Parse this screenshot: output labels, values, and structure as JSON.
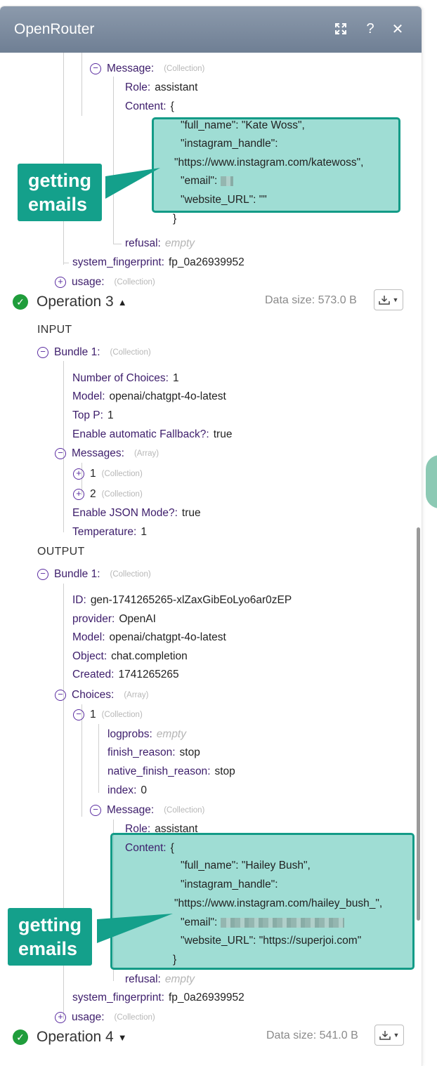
{
  "window": {
    "title": "OpenRouter"
  },
  "top": {
    "message_label": "Message",
    "collection": "(Collection)",
    "role_label": "Role",
    "role_value": "assistant",
    "content_label": "Content",
    "content_open": "{",
    "json_lines": [
      "\"full_name\": \"Kate Woss\",",
      "\"instagram_handle\":",
      "\"https://www.instagram.com/katewoss\",",
      "\"email\":",
      "\"website_URL\": \"\""
    ],
    "content_close": "}",
    "refusal_label": "refusal",
    "refusal_value": "empty",
    "fingerprint_label": "system_fingerprint",
    "fingerprint_value": "fp_0a26939952",
    "usage_label": "usage"
  },
  "callout_text": "getting\nemails",
  "op3": {
    "title": "Operation 3",
    "data_size": "Data size: 573.0 B",
    "input_label": "INPUT",
    "output_label": "OUTPUT",
    "bundle_label": "Bundle 1",
    "collection": "(Collection)",
    "array": "(Array)",
    "input": {
      "choices_label": "Number of Choices",
      "choices_value": "1",
      "model_label": "Model",
      "model_value": "openai/chatgpt-4o-latest",
      "topp_label": "Top P",
      "topp_value": "1",
      "fallback_label": "Enable automatic Fallback?",
      "fallback_value": "true",
      "messages_label": "Messages",
      "msg1": "1",
      "msg2": "2",
      "json_label": "Enable JSON Mode?",
      "json_value": "true",
      "temp_label": "Temperature",
      "temp_value": "1"
    },
    "output": {
      "id_label": "ID",
      "id_value": "gen-1741265265-xlZaxGibEoLyo6ar0zEP",
      "provider_label": "provider",
      "provider_value": "OpenAI",
      "model_label": "Model",
      "model_value": "openai/chatgpt-4o-latest",
      "object_label": "Object",
      "object_value": "chat.completion",
      "created_label": "Created",
      "created_value": "1741265265",
      "choices_label": "Choices",
      "item1": "1",
      "logprobs_label": "logprobs",
      "logprobs_value": "empty",
      "finish_label": "finish_reason",
      "finish_value": "stop",
      "native_label": "native_finish_reason",
      "native_value": "stop",
      "index_label": "index",
      "index_value": "0",
      "message_label": "Message",
      "role_label": "Role",
      "role_value": "assistant",
      "content_label": "Content",
      "content_open": "{",
      "json_lines": [
        "\"full_name\": \"Hailey Bush\",",
        "\"instagram_handle\":",
        "\"https://www.instagram.com/hailey_bush_\",",
        "\"email\":",
        "\"website_URL\": \"https://superjoi.com\""
      ],
      "content_close": "}",
      "refusal_label": "refusal",
      "refusal_value": "empty",
      "fingerprint_label": "system_fingerprint",
      "fingerprint_value": "fp_0a26939952",
      "usage_label": "usage"
    }
  },
  "op4": {
    "title": "Operation 4",
    "data_size": "Data size: 541.0 B"
  }
}
